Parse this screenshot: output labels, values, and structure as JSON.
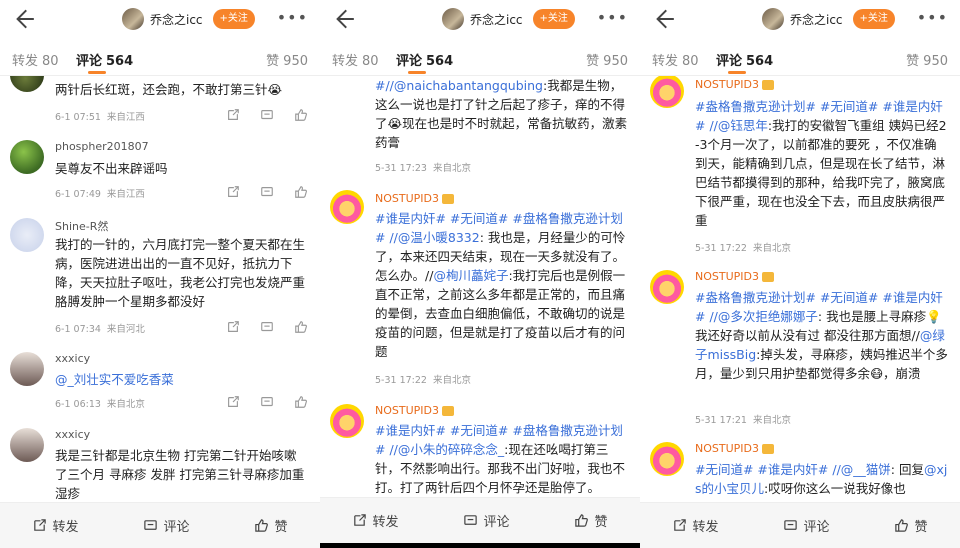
{
  "header": {
    "username": "乔念之icc",
    "follow_label": "+关注",
    "more": "•••"
  },
  "tabs": {
    "repost_label": "转发",
    "repost_count": "80",
    "comment_label": "评论",
    "comment_count": "564",
    "like_label": "赞",
    "like_count": "950"
  },
  "bottom": {
    "repost": "转发",
    "comment": "评论",
    "like": "赞"
  },
  "p1": {
    "c0": {
      "text": "两针后长红斑，还会跑，不敢打第三针😭",
      "date": "6-1 07:51",
      "loc": "来自江西"
    },
    "c1": {
      "name": "phospher201807",
      "text": "吴尊友不出来辟谣吗",
      "date": "6-1 07:49",
      "loc": "来自江西"
    },
    "c2": {
      "name": "Shine-R然",
      "text": "我打的一针的，六月底打完一整个夏天都在生病，医院进进出出的一直不见好，抵抗力下降，天天拉肚子呕吐，我老公打完也发烧严重胳膊发肿一个星期多都没好",
      "date": "6-1 07:34",
      "loc": "来自河北"
    },
    "c3": {
      "name": "xxxicy",
      "mention": "@_刘壮实不爱吃香菜",
      "date": "6-1 06:13",
      "loc": "来自北京"
    },
    "c4": {
      "name": "xxxicy",
      "text": "我是三针都是北京生物 打完第二针开始咳嗽了三个月 寻麻疹 发胖 打完第三针寻麻疹加重 湿疹"
    }
  },
  "p2": {
    "c0": {
      "prefix": "#//",
      "mention": "@naichabantangqubing",
      "text": ":我都是生物，这么一说也是打了针之后起了疹子，痒的不得了😭现在也是时不时就起，常备抗敏药，激素药膏",
      "date": "5-31 17:23",
      "loc": "来自北京"
    },
    "c1": {
      "name": "NOSTUPID3",
      "tags": "#谁是内奸# #无间道# #盘格鲁撒克逊计划#",
      "m1": "//@温小暖8332",
      "t1": ": 我也是，月经量少的可怜了，本来还四天结束，现在一天多就没有了。怎么办。//",
      "m2": "@栒川藟姹子",
      "t2": ":我打完后也是例假一直不正常，之前这么多年都是正常的，而且痛的晕倒，去查血白细胞偏低，不敢确切的说是疫苗的问题，但是就是打了疫苗以后才有的问题",
      "date": "5-31 17:22",
      "loc": "来自北京"
    },
    "c2": {
      "name": "NOSTUPID3",
      "tags": "#谁是内奸# #无间道# #盘格鲁撒克逊计划#",
      "m1": "//@小朱的碎碎念念_",
      "t1": ":现在还吆喝打第三针，不然影响出行。那我不出门好啦，我也不打。打了两针后四个月怀孕还是胎停了。"
    }
  },
  "p3": {
    "c0": {
      "name": "NOSTUPID3",
      "tags": "#盎格鲁撒克逊计划# #无间道# #谁是内奸#",
      "m1": "//@钰思年",
      "t1": ":我打的安徽智飞重组 姨妈已经2-3个月一次了，以前都准的要死 ，不仅准确到天，能精确到几点，但是现在长了结节，淋巴结节都摸得到的那种，给我吓完了，腋窝底下很严重，现在也没全下去，而且皮肤病很严重",
      "date": "5-31 17:22",
      "loc": "来自北京"
    },
    "c1": {
      "name": "NOSTUPID3",
      "tags": "#盎格鲁撒克逊计划# #无间道# #谁是内奸#",
      "m1": "//@多次拒绝娜娜子",
      "t1": ": 我也是腰上寻麻疹💡我还好奇以前从没有过 都没往那方面想//",
      "m2": "@绿子missBig",
      "t2": ":掉头发，寻麻疹，姨妈推迟半个多月，量少到只用护垫都觉得多余😷，崩溃",
      "date": "5-31 17:21",
      "loc": "来自北京"
    },
    "c2": {
      "name": "NOSTUPID3",
      "tags": "#无间道# #谁是内奸#",
      "m1": "//@__猫饼",
      "t1": ": 回复",
      "m2": "@xjs的小宝贝儿",
      "t2": ":哎呀你这么一说我好像也"
    }
  }
}
